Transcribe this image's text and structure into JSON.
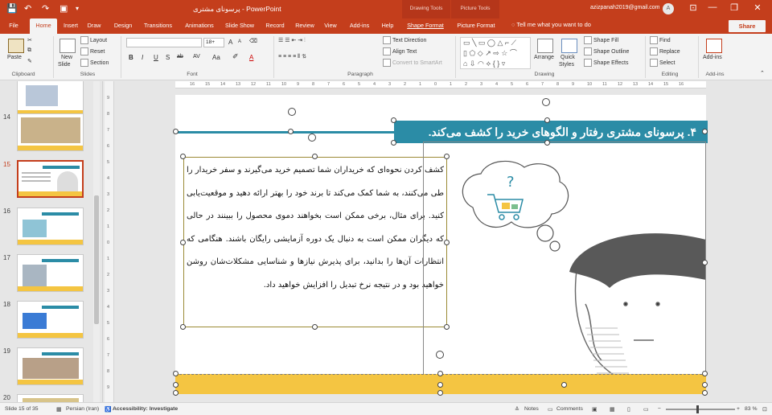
{
  "titlebar": {
    "document_title": "پرسونای مشتری - PowerPoint",
    "context_tab_drawing": "Drawing Tools",
    "context_tab_picture": "Picture Tools",
    "user_email": "azizpanah2019@gmail.com",
    "avatar_letter": "A",
    "save_icon": "💾",
    "undo_icon": "↶",
    "redo_icon": "↷",
    "present_icon": "▣",
    "customize_icon": "▾",
    "ribbon_display_icon": "⊡",
    "minimize_icon": "—",
    "restore_icon": "❐",
    "close_icon": "✕"
  },
  "tabs": [
    "File",
    "Home",
    "Insert",
    "Draw",
    "Design",
    "Transitions",
    "Animations",
    "Slide Show",
    "Record",
    "Review",
    "View",
    "Add-ins",
    "Help",
    "Shape Format",
    "Picture Format"
  ],
  "tell_me": "Tell me what you want to do",
  "share_label": "Share",
  "ribbon": {
    "clipboard": {
      "group": "Clipboard",
      "paste": "Paste"
    },
    "slides": {
      "group": "Slides",
      "new_slide": "New",
      "new_slide2": "Slide",
      "layout": "Layout",
      "reset": "Reset",
      "section": "Section"
    },
    "font": {
      "group": "Font",
      "font_name": "",
      "font_size": "18+",
      "bold": "B",
      "italic": "I",
      "underline": "U",
      "strike": "S",
      "shadow": "ab",
      "spacing": "AV",
      "case": "Aa",
      "color": "A",
      "grow": "A",
      "shrink": "A"
    },
    "paragraph": {
      "group": "Paragraph",
      "text_direction": "Text Direction",
      "align_text": "Align Text",
      "convert_smartart": "Convert to SmartArt"
    },
    "drawing": {
      "group": "Drawing",
      "arrange": "Arrange",
      "quick_styles": "Quick",
      "quick_styles2": "Styles",
      "shape_fill": "Shape Fill",
      "shape_outline": "Shape Outline",
      "shape_effects": "Shape Effects"
    },
    "editing": {
      "group": "Editing",
      "find": "Find",
      "replace": "Replace",
      "select": "Select"
    },
    "addins": {
      "group": "Add-ins",
      "addins": "Add-ins"
    }
  },
  "slides_panel": [
    {
      "num": "",
      "selected": false
    },
    {
      "num": "14",
      "selected": false
    },
    {
      "num": "15",
      "selected": true
    },
    {
      "num": "16",
      "selected": false
    },
    {
      "num": "17",
      "selected": false
    },
    {
      "num": "18",
      "selected": false
    },
    {
      "num": "19",
      "selected": false
    },
    {
      "num": "20",
      "selected": false
    }
  ],
  "ruler_h": [
    "16",
    "15",
    "14",
    "13",
    "12",
    "11",
    "10",
    "9",
    "8",
    "7",
    "6",
    "5",
    "4",
    "3",
    "2",
    "1",
    "0",
    "1",
    "2",
    "3",
    "4",
    "5",
    "6",
    "7",
    "8",
    "9",
    "10",
    "11",
    "12",
    "13",
    "14",
    "15",
    "16"
  ],
  "ruler_v": [
    "9",
    "8",
    "7",
    "6",
    "5",
    "4",
    "3",
    "2",
    "1",
    "0",
    "1",
    "2",
    "3",
    "4",
    "5",
    "6",
    "7",
    "8",
    "9"
  ],
  "slide": {
    "title": "۴. پرسونای مشتری رفتار و الگوهای خرید را کشف می‌کند.",
    "body": "کشف کردن نحوه‌ای که خریداران شما تصمیم خرید می‌گیرند و سفر خریدار را طی می‌کنند، به شما کمک می‌کند تا برند خود را بهتر ارائه دهید و موقعیت‌یابی کنید. برای مثال، برخی ممکن است بخواهند دموی محصول را ببینند در حالی که دیگران ممکن است به دنبال یک دوره آزمایشی رایگان باشند. هنگامی که انتظارات آن‌ها را بدانید، برای پذیرش نیازها و شناسایی مشکلات‌شان روشن خواهید بود و در نتیجه نرخ تبدیل را افزایش خواهید داد."
  },
  "status": {
    "slide_info": "Slide 15 of 35",
    "language": "Persian (Iran)",
    "accessibility": "Accessibility: Investigate",
    "notes": "Notes",
    "comments": "Comments",
    "zoom": "83 %",
    "zoom_out": "−",
    "zoom_in": "+"
  },
  "colors": {
    "accent": "#c43e1c",
    "title_bar": "#2b8ca6",
    "band": "#f4c542"
  }
}
